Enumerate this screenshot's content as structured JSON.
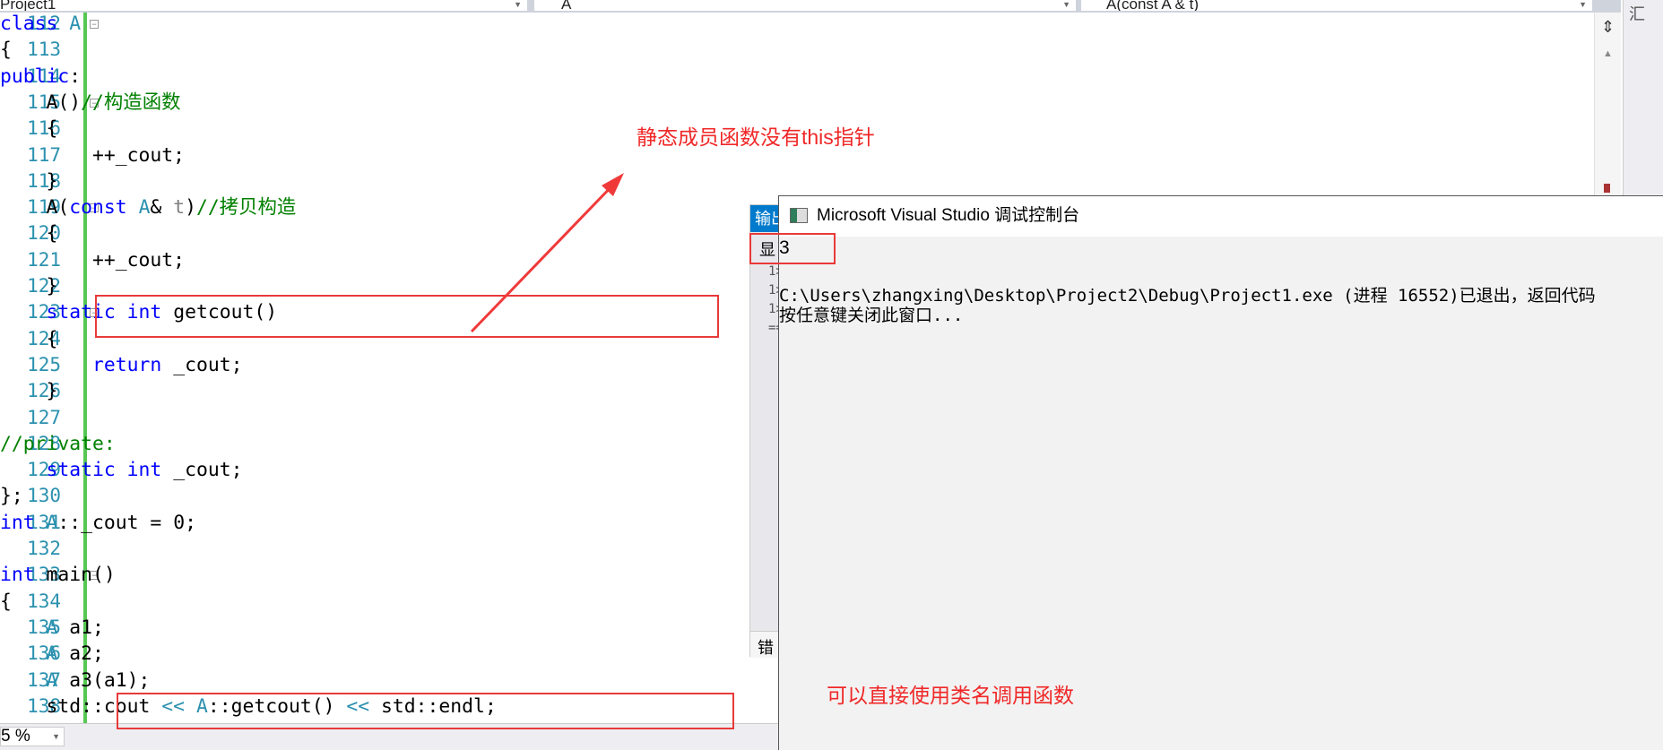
{
  "toolbar": {
    "project": "Project1",
    "class_scope": "A",
    "member_scope": "A(const A & t)"
  },
  "right_panel": {
    "label": "汇"
  },
  "code": {
    "lines": [
      {
        "num": "112",
        "fold": true,
        "segs": [
          [
            "class ",
            "kw"
          ],
          [
            "A",
            "ty"
          ]
        ]
      },
      {
        "num": "113",
        "segs": [
          [
            "{",
            ""
          ]
        ]
      },
      {
        "num": "114",
        "segs": [
          [
            "public",
            "kw"
          ],
          [
            ":",
            ""
          ]
        ]
      },
      {
        "num": "115",
        "fold": true,
        "segs": [
          [
            "    A()",
            ""
          ],
          [
            "//构造函数",
            "cm"
          ]
        ]
      },
      {
        "num": "116",
        "segs": [
          [
            "    {",
            ""
          ]
        ]
      },
      {
        "num": "117",
        "segs": [
          [
            "        ++_cout;",
            ""
          ]
        ]
      },
      {
        "num": "118",
        "segs": [
          [
            "    }",
            ""
          ]
        ]
      },
      {
        "num": "119",
        "fold": true,
        "segs": [
          [
            "    A(",
            ""
          ],
          [
            "const ",
            "kw"
          ],
          [
            "A",
            "ty"
          ],
          [
            "& ",
            ""
          ],
          [
            "t",
            "pm"
          ],
          [
            ")",
            ""
          ],
          [
            "//拷贝构造",
            "cm"
          ]
        ]
      },
      {
        "num": "120",
        "segs": [
          [
            "    {",
            ""
          ]
        ]
      },
      {
        "num": "121",
        "segs": [
          [
            "        ++_cout;",
            ""
          ]
        ]
      },
      {
        "num": "122",
        "segs": [
          [
            "    }",
            ""
          ]
        ]
      },
      {
        "num": "123",
        "fold": true,
        "segs": [
          [
            "    ",
            ""
          ],
          [
            "static int ",
            "kw"
          ],
          [
            "getcout()",
            ""
          ]
        ]
      },
      {
        "num": "124",
        "segs": [
          [
            "    {",
            ""
          ]
        ]
      },
      {
        "num": "125",
        "segs": [
          [
            "        ",
            ""
          ],
          [
            "return ",
            "kw"
          ],
          [
            "_cout;",
            ""
          ]
        ]
      },
      {
        "num": "126",
        "segs": [
          [
            "    }",
            ""
          ]
        ]
      },
      {
        "num": "127",
        "segs": [
          [
            "",
            ""
          ]
        ]
      },
      {
        "num": "128",
        "segs": [
          [
            "//private:",
            "cm"
          ]
        ]
      },
      {
        "num": "129",
        "segs": [
          [
            "    ",
            ""
          ],
          [
            "static int ",
            "kw"
          ],
          [
            "_cout;",
            ""
          ]
        ]
      },
      {
        "num": "130",
        "segs": [
          [
            "};",
            ""
          ]
        ]
      },
      {
        "num": "131",
        "segs": [
          [
            "int ",
            "kw"
          ],
          [
            "A",
            "ty"
          ],
          [
            "::_cout = 0;",
            ""
          ]
        ]
      },
      {
        "num": "132",
        "segs": [
          [
            "",
            ""
          ]
        ]
      },
      {
        "num": "133",
        "fold": true,
        "segs": [
          [
            "int ",
            "kw"
          ],
          [
            "main()",
            ""
          ]
        ]
      },
      {
        "num": "134",
        "segs": [
          [
            "{",
            ""
          ]
        ]
      },
      {
        "num": "135",
        "segs": [
          [
            "    ",
            ""
          ],
          [
            "A",
            "ty"
          ],
          [
            " a1;",
            ""
          ]
        ]
      },
      {
        "num": "136",
        "segs": [
          [
            "    ",
            ""
          ],
          [
            "A",
            "ty"
          ],
          [
            " a2;",
            ""
          ]
        ]
      },
      {
        "num": "137",
        "segs": [
          [
            "    ",
            ""
          ],
          [
            "A",
            "ty"
          ],
          [
            " a3(a1);",
            ""
          ]
        ]
      },
      {
        "num": "138",
        "segs": [
          [
            "    std::cout ",
            ""
          ],
          [
            "<<",
            "ty"
          ],
          [
            " ",
            ""
          ],
          [
            "A",
            "ty"
          ],
          [
            "::getcout() ",
            ""
          ],
          [
            "<<",
            "ty"
          ],
          [
            " std::endl;",
            ""
          ]
        ]
      }
    ]
  },
  "status": {
    "zoom": "5 %"
  },
  "output_panel": {
    "title": "输出",
    "show_label": "显",
    "lines": [
      "1>",
      "1>",
      "1>",
      "=="
    ],
    "errors_tab": "错"
  },
  "console": {
    "title": "Microsoft Visual Studio 调试控制台",
    "output": "3",
    "exit_line": "C:\\Users\\zhangxing\\Desktop\\Project2\\Debug\\Project1.exe (进程 16552)已退出，返回代码",
    "prompt_line": "按任意键关闭此窗口..."
  },
  "annotations": {
    "note1": "静态成员函数没有this指针",
    "note2": "可以直接使用类名调用函数",
    "color": "#f02828"
  }
}
